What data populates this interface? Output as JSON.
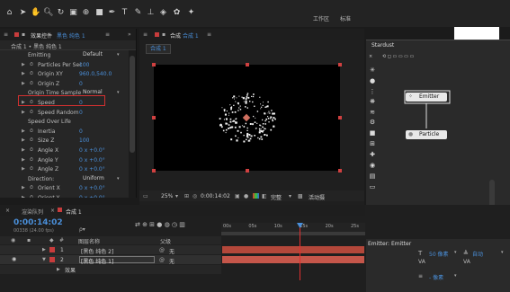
{
  "toolbar": {
    "workspace_label": "工作区",
    "workspace_value": "标准"
  },
  "effect_controls": {
    "tab_label": "效果控件",
    "tab_layer": "黑色 纯色 1",
    "tab_menu": "≡",
    "collapse": "»",
    "sub_header": "合成 1 • 黑色 纯色 1",
    "rows": [
      {
        "name": "Emitting",
        "value": "Default",
        "kind": "select",
        "indent": 1
      },
      {
        "name": "Particles Per Sec",
        "value": "100",
        "kind": "value",
        "indent": 2
      },
      {
        "name": "Origin XY",
        "value": "960.0,540.0",
        "kind": "value",
        "indent": 2
      },
      {
        "name": "Origin Z",
        "value": "0",
        "kind": "value",
        "indent": 2
      },
      {
        "name": "Origin Time Sample",
        "value": "Normal",
        "kind": "select",
        "indent": 1
      },
      {
        "name": "Speed",
        "value": "0",
        "kind": "value",
        "indent": 2
      },
      {
        "name": "Speed Random",
        "value": "0",
        "kind": "value",
        "indent": 2
      },
      {
        "name": "Speed Over Life",
        "value": "",
        "kind": "group",
        "indent": 0
      },
      {
        "name": "Inertia",
        "value": "0",
        "kind": "value",
        "indent": 2
      },
      {
        "name": "Size Z",
        "value": "100",
        "kind": "value",
        "indent": 2
      },
      {
        "name": "Angle X",
        "value": "0 x +0.0°",
        "kind": "value",
        "indent": 2
      },
      {
        "name": "Angle Y",
        "value": "0 x +0.0°",
        "kind": "value",
        "indent": 2
      },
      {
        "name": "Angle Z",
        "value": "0 x +0.0°",
        "kind": "value",
        "indent": 2
      },
      {
        "name": "Direction:",
        "value": "Uniform",
        "kind": "select",
        "indent": 1
      },
      {
        "name": "Orient X",
        "value": "0 x +0.0°",
        "kind": "value",
        "indent": 2
      },
      {
        "name": "Orient Y",
        "value": "0 x +0.0°",
        "kind": "value",
        "indent": 2
      }
    ]
  },
  "composition": {
    "tab_label": "合成",
    "tab_name": "合成 1",
    "tab_menu": "≡",
    "chip": "合成 1",
    "zoom": "25%",
    "timecode": "0:00:14:02",
    "quality": "完整",
    "activity": "活动摄"
  },
  "stardust": {
    "title": "Stardust",
    "close": "×",
    "toolbar_text": "⟲ ◻ ▭ ▭ ▭ ▭",
    "node_emitter": "Emitter",
    "node_particle": "Particle"
  },
  "timeline": {
    "tab_render": "渲染队列",
    "tab_comp": "合成 1",
    "timecode": "0:00:14:02",
    "fps": "00338 (24.00 fps)",
    "search_placeholder": "ρ▾",
    "col_name": "图层名称",
    "col_parent": "父级",
    "layers": [
      {
        "num": "1",
        "name": "[黑色 纯色 2]",
        "parent": "无"
      },
      {
        "name": "[黑色 纯色 1]",
        "num": "2",
        "parent": "无"
      }
    ],
    "effect_row": "效果",
    "ruler": [
      "00s",
      "05s",
      "10s",
      "15s",
      "20s",
      "25s"
    ]
  },
  "emitter_panel": {
    "title": "Emitter: Emitter",
    "size_value": "50 像素",
    "size_auto": "自动",
    "letter_spacing": "- 像素"
  }
}
